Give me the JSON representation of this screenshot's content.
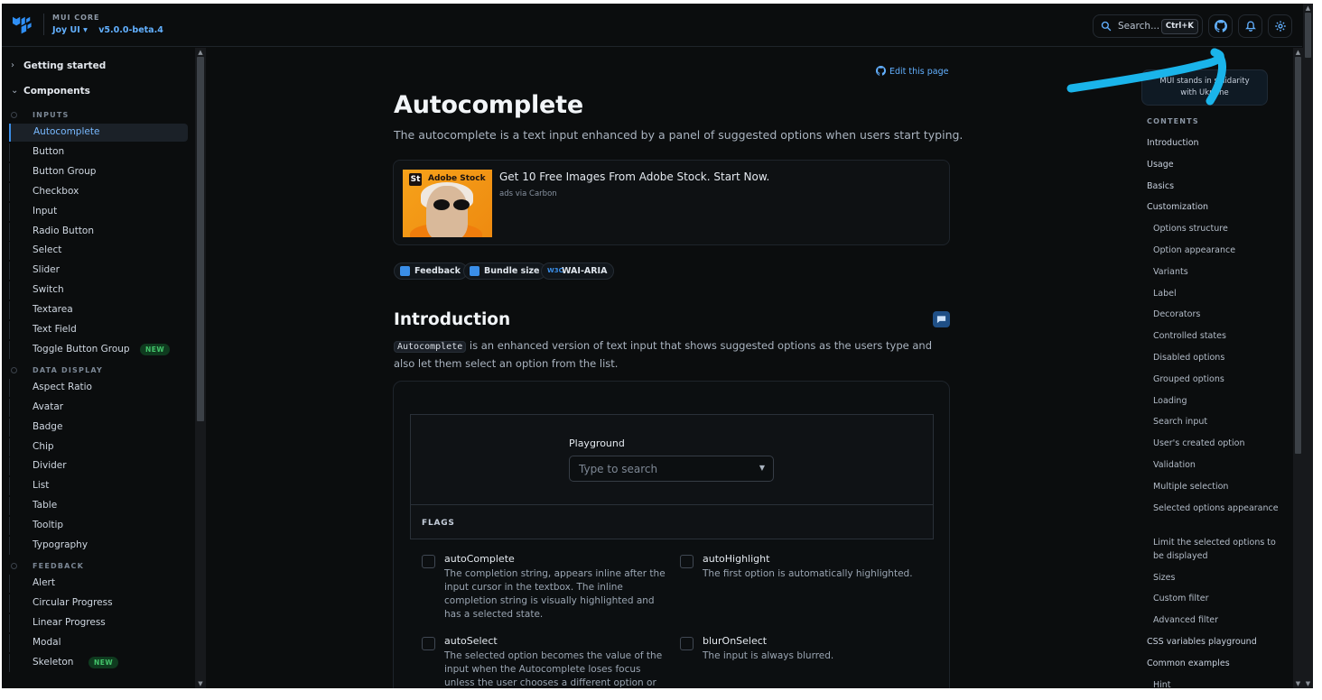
{
  "header": {
    "org": "MUI CORE",
    "product": "Joy UI",
    "product_caret": "▾",
    "version": "v5.0.0-beta.4",
    "search_label": "Search...",
    "search_shortcut": "Ctrl+K"
  },
  "sidebar": {
    "getting_started": "Getting started",
    "components": "Components",
    "sections": [
      {
        "title": "INPUTS",
        "items": [
          "Autocomplete",
          "Button",
          "Button Group",
          "Checkbox",
          "Input",
          "Radio Button",
          "Select",
          "Slider",
          "Switch",
          "Textarea",
          "Text Field",
          "Toggle Button Group"
        ]
      },
      {
        "title": "DATA DISPLAY",
        "items": [
          "Aspect Ratio",
          "Avatar",
          "Badge",
          "Chip",
          "Divider",
          "List",
          "Table",
          "Tooltip",
          "Typography"
        ]
      },
      {
        "title": "FEEDBACK",
        "items": [
          "Alert",
          "Circular Progress",
          "Linear Progress",
          "Modal",
          "Skeleton"
        ]
      }
    ],
    "active_item": "Autocomplete",
    "new_badge": "NEW"
  },
  "page": {
    "edit_link": "Edit this page",
    "title": "Autocomplete",
    "description": "The autocomplete is a text input enhanced by a panel of suggested options when users start typing.",
    "ad": {
      "badge": "St",
      "brand": "Adobe Stock",
      "title": "Get 10 Free Images From Adobe Stock. Start Now.",
      "via": "ads via Carbon"
    },
    "chips": [
      "Feedback",
      "Bundle size",
      "WAI-ARIA"
    ],
    "chip_w3c": "W3C",
    "intro_heading": "Introduction",
    "intro_code": "Autocomplete",
    "intro_text": " is an enhanced version of text input that shows suggested options as the users type and also let them select an option from the list.",
    "playground": {
      "label": "Playground",
      "placeholder": "Type to search",
      "flags_label": "FLAGS"
    },
    "flags": [
      {
        "name": "autoComplete",
        "desc": "The completion string, appears inline after the input cursor in the textbox. The inline completion string is visually highlighted and has a selected state."
      },
      {
        "name": "autoHighlight",
        "desc": "The first option is automatically highlighted."
      },
      {
        "name": "autoSelect",
        "desc": "The selected option becomes the value of the input when the Autocomplete loses focus unless the user chooses a different option or changes"
      },
      {
        "name": "blurOnSelect",
        "desc": "The input is always blurred."
      }
    ]
  },
  "toc": {
    "ukraine_line1": "MUI stands in solidarity",
    "ukraine_line2": "with Ukraine",
    "heading": "CONTENTS",
    "items": [
      {
        "label": "Introduction",
        "level": 1
      },
      {
        "label": "Usage",
        "level": 1
      },
      {
        "label": "Basics",
        "level": 1
      },
      {
        "label": "Customization",
        "level": 1
      },
      {
        "label": "Options structure",
        "level": 2
      },
      {
        "label": "Option appearance",
        "level": 2
      },
      {
        "label": "Variants",
        "level": 2
      },
      {
        "label": "Label",
        "level": 2
      },
      {
        "label": "Decorators",
        "level": 2
      },
      {
        "label": "Controlled states",
        "level": 2
      },
      {
        "label": "Disabled options",
        "level": 2
      },
      {
        "label": "Grouped options",
        "level": 2
      },
      {
        "label": "Loading",
        "level": 2
      },
      {
        "label": "Search input",
        "level": 2
      },
      {
        "label": "User's created option",
        "level": 2
      },
      {
        "label": "Validation",
        "level": 2
      },
      {
        "label": "Multiple selection",
        "level": 2
      },
      {
        "label": "Selected options appearance",
        "level": 2
      },
      {
        "label": "Limit the selected options to be displayed",
        "level": 2
      },
      {
        "label": "Sizes",
        "level": 2
      },
      {
        "label": "Custom filter",
        "level": 2
      },
      {
        "label": "Advanced filter",
        "level": 2
      },
      {
        "label": "CSS variables playground",
        "level": 1
      },
      {
        "label": "Common examples",
        "level": 1
      },
      {
        "label": "Hint",
        "level": 2
      }
    ]
  },
  "colors": {
    "accent": "#3a8ee8",
    "background": "#0b0d0e",
    "swoosh": "#1ab4ea"
  }
}
